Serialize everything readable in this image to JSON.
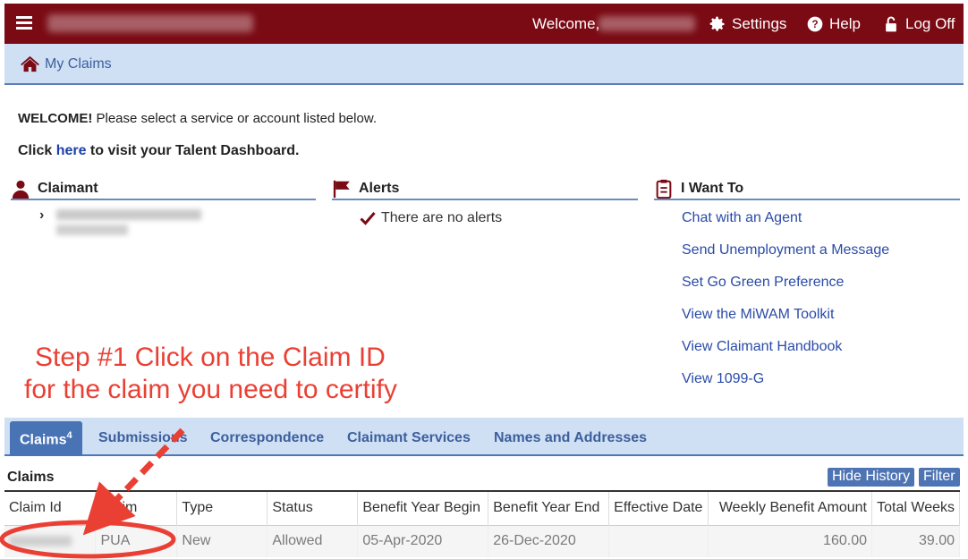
{
  "topbar": {
    "welcome_label": "Welcome,",
    "settings_label": "Settings",
    "help_label": "Help",
    "logoff_label": "Log Off"
  },
  "breadcrumb": {
    "label": "My Claims"
  },
  "intro": {
    "welcome_bold": "WELCOME!",
    "welcome_text": " Please select a service or account listed below.",
    "talent_prefix": "Click ",
    "talent_link": "here",
    "talent_suffix": " to visit your Talent Dashboard."
  },
  "sections": {
    "claimant": "Claimant",
    "alerts": "Alerts",
    "want": "I Want To"
  },
  "alerts": {
    "empty": "There are no alerts"
  },
  "want_links": [
    "Chat with an Agent",
    "Send Unemployment a Message",
    "Set Go Green Preference",
    "View the MiWAM Toolkit",
    "View Claimant Handbook",
    "View 1099-G"
  ],
  "annotation": {
    "line1": "Step #1 Click on the Claim ID",
    "line2": "for the claim you need to certify"
  },
  "tabs": {
    "claims": "Claims",
    "claims_count": "4",
    "submissions": "Submissions",
    "correspondence": "Correspondence",
    "claimant_services": "Claimant Services",
    "names_addresses": "Names and Addresses"
  },
  "claims_panel": {
    "title": "Claims",
    "hide_history": "Hide History",
    "filter": "Filter"
  },
  "table": {
    "headers": [
      "Claim Id",
      "Claim",
      "Type",
      "Status",
      "Benefit Year Begin",
      "Benefit Year End",
      "Effective Date",
      "Weekly Benefit Amount",
      "Total Weeks"
    ],
    "row": {
      "claim": "PUA",
      "type": "New",
      "status": "Allowed",
      "begin": "05-Apr-2020",
      "end": "26-Dec-2020",
      "effective": "",
      "weekly": "160.00",
      "weeks": "39.00"
    }
  },
  "colors": {
    "topbar": "#7a0a14",
    "accent_blue": "#4873b4",
    "annotation_red": "#ea4034"
  }
}
